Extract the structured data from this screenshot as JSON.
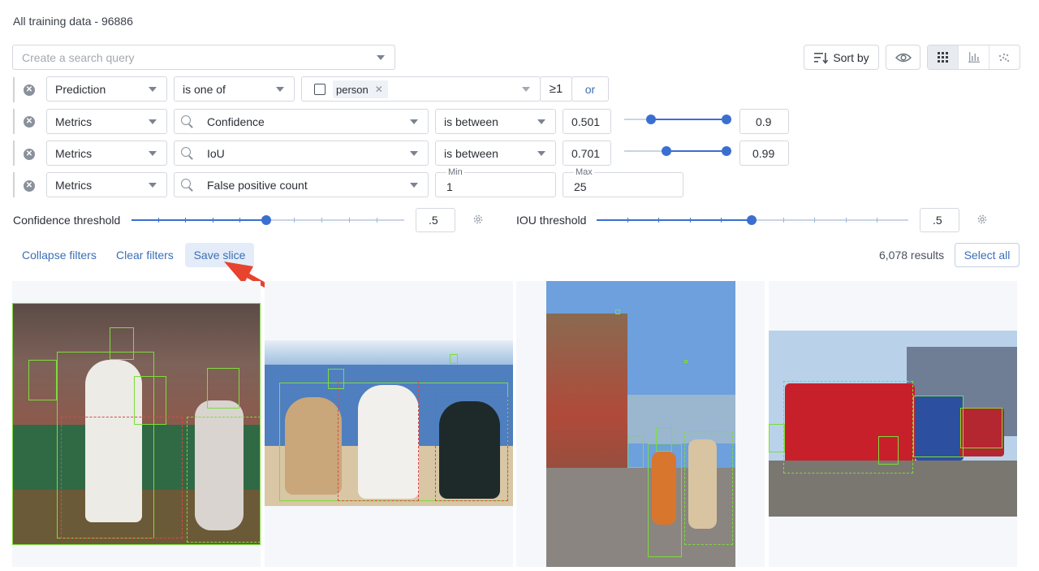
{
  "header": {
    "title": "All training data - 96886"
  },
  "search": {
    "placeholder": "Create a search query"
  },
  "toolbar": {
    "sort_label": "Sort by"
  },
  "filters": [
    {
      "field": "Prediction",
      "operator": "is one of",
      "chip": "person",
      "count_label": "≥1",
      "or_label": "or"
    },
    {
      "field": "Metrics",
      "metric": "Confidence",
      "operator": "is between",
      "min": "0.501",
      "max": "0.9"
    },
    {
      "field": "Metrics",
      "metric": "IoU",
      "operator": "is between",
      "min": "0.701",
      "max": "0.99"
    },
    {
      "field": "Metrics",
      "metric": "False positive count",
      "min_label": "Min",
      "min": "1",
      "max_label": "Max",
      "max": "25"
    }
  ],
  "thresholds": {
    "confidence_label": "Confidence threshold",
    "confidence_value": ".5",
    "iou_label": "IOU threshold",
    "iou_value": ".5"
  },
  "actions": {
    "collapse": "Collapse filters",
    "clear": "Clear filters",
    "save": "Save slice",
    "results": "6,078 results",
    "select_all": "Select all"
  },
  "colors": {
    "accent": "#3a6fd0",
    "box_green": "#7ddc3c",
    "box_red": "#d84a4a",
    "arrow": "#e8432e"
  }
}
